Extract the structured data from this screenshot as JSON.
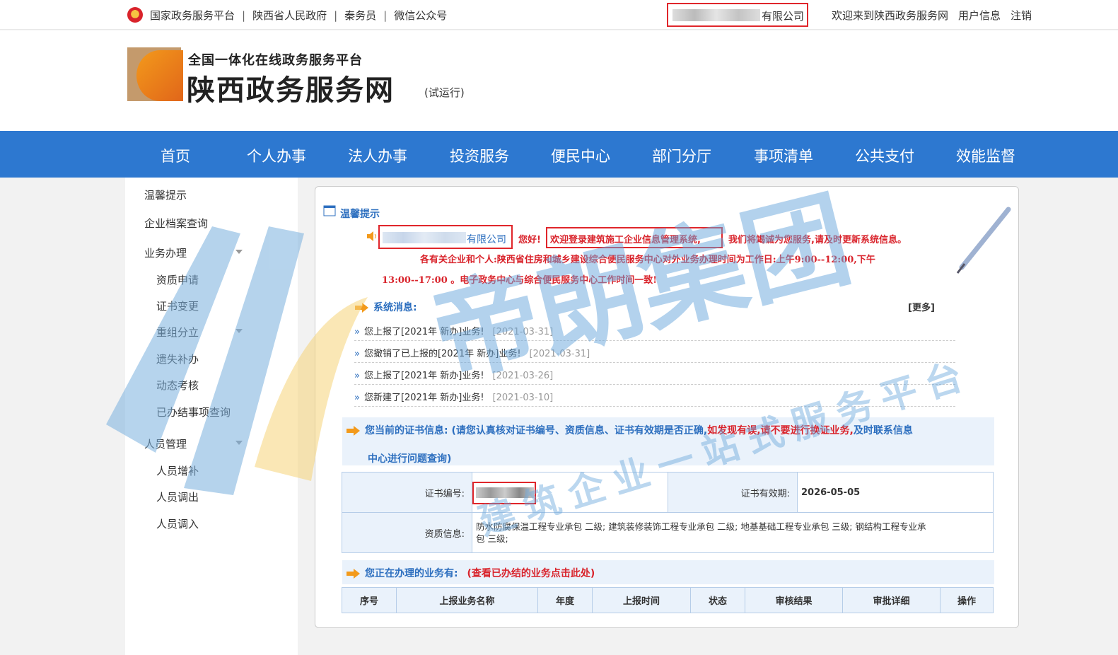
{
  "topbar": {
    "links": [
      "国家政务服务平台",
      "陕西省人民政府",
      "秦务员",
      "微信公众号"
    ],
    "company_suffix": "有限公司",
    "welcome": "欢迎来到陕西政务服务网",
    "user_info": "用户信息",
    "logout": "注销"
  },
  "header": {
    "subtitle": "全国一体化在线政务服务平台",
    "title": "陕西政务服务网",
    "trial": "(试运行)"
  },
  "nav": [
    "首页",
    "个人办事",
    "法人办事",
    "投资服务",
    "便民中心",
    "部门分厅",
    "事项清单",
    "公共支付",
    "效能监督"
  ],
  "sidebar": {
    "items": [
      "温馨提示",
      "企业档案查询",
      "业务办理",
      "资质申请",
      "证书变更",
      "重组分立",
      "遗失补办",
      "动态考核",
      "已办结事项查询",
      "人员管理",
      "人员增补",
      "人员调出",
      "人员调入"
    ]
  },
  "tip": {
    "title": "温馨提示",
    "company_suffix": "有限公司",
    "greeting": "您好!",
    "welcome_system": "欢迎登录建筑施工企业信息管理系统,",
    "service_text": "我们将竭诚为您服务,请及时更新系统信息。",
    "notice_line1": "各有关企业和个人:陕西省住房和城乡建设综合便民服务中心对外业务办理时间为工作日:上午9:00--12:00,下午",
    "notice_line2": "13:00--17:00 。电子政务中心与综合便民服务中心工作时间一致!"
  },
  "messages": {
    "title": "系统消息:",
    "more": "[更多]",
    "items": [
      {
        "text": "您上报了[2021年 新办]业务!",
        "date": "[2021-03-31]"
      },
      {
        "text": "您撤销了已上报的[2021年 新办]业务!",
        "date": "[2021-03-31]"
      },
      {
        "text": "您上报了[2021年 新办]业务!",
        "date": "[2021-03-26]"
      },
      {
        "text": "您新建了[2021年 新办]业务!",
        "date": "[2021-03-10]"
      }
    ]
  },
  "cert": {
    "head_label": "您当前的证书信息:",
    "head_blue1": "(请您认真核对证书编号、资质信息、证书有效期是否正确,",
    "head_red": "如发现有误,请不要进行换证业务,",
    "head_blue2": "及时联系信息",
    "head_blue3": "中心进行问题查询)",
    "number_label": "证书编号:",
    "expiry_label": "证书有效期:",
    "expiry_value": "2026-05-05",
    "qual_label": "资质信息:",
    "qual_value1": "防水防腐保温工程专业承包 二级; 建筑装修装饰工程专业承包 二级; 地基基础工程专业承包 三级; 钢结构工程专业承",
    "qual_value2": "包 三级;"
  },
  "business": {
    "head_label": "您正在办理的业务有:",
    "head_link": "(查看已办结的业务点击此处)",
    "columns": [
      "序号",
      "上报业务名称",
      "年度",
      "上报时间",
      "状态",
      "审核结果",
      "审批详细",
      "操作"
    ]
  },
  "watermark": {
    "brand": "帝朗集团",
    "slogan": "建筑企业一站式服务平台"
  },
  "colors": {
    "nav_blue": "#2d78d0",
    "alert_red": "#d9232b",
    "link_blue": "#2d6fbf"
  }
}
